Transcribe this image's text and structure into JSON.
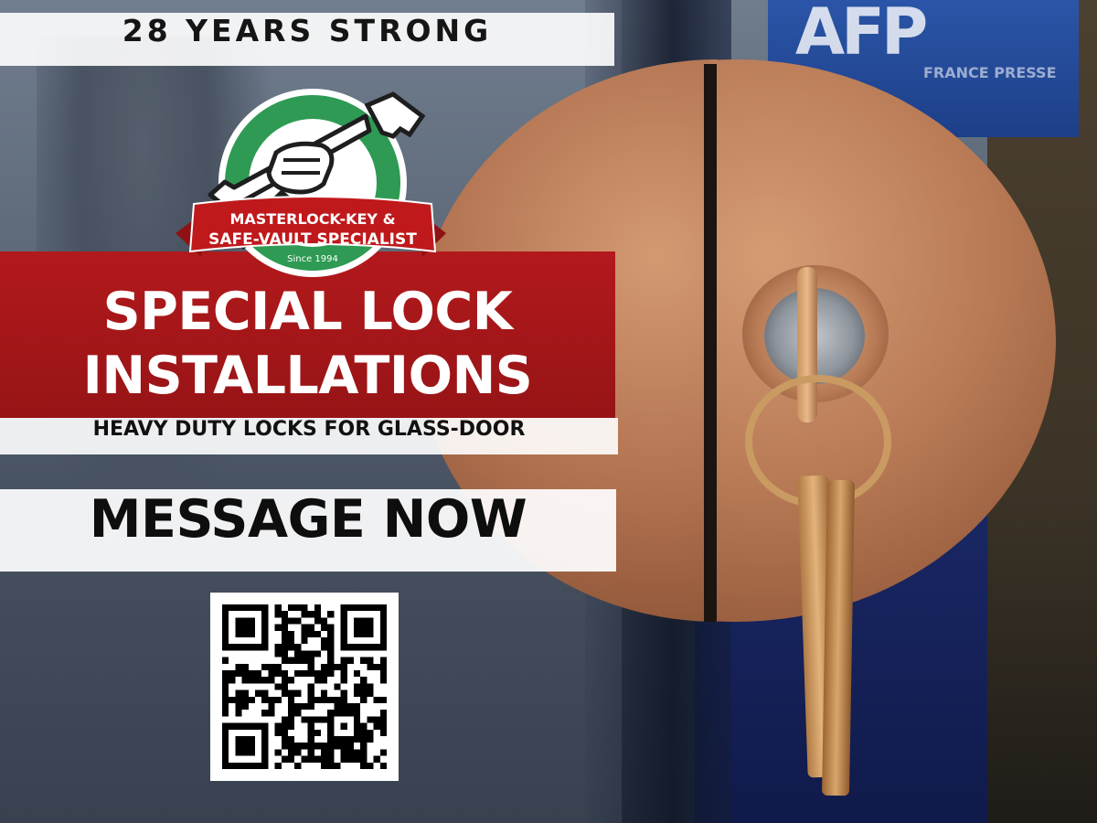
{
  "badge": {
    "years_text": "28 YEARS STRONG"
  },
  "logo": {
    "line1": "MASTERLOCK-KEY &",
    "line2": "SAFE-VAULT SPECIALIST",
    "since": "Since 1994",
    "colors": {
      "green": "#2e9a53",
      "red": "#c0191c",
      "dark": "#1e1e1e"
    }
  },
  "headline": {
    "line1": "SPECIAL LOCK",
    "line2": "INSTALLATIONS",
    "subtitle": "HEAVY DUTY LOCKS FOR GLASS-DOOR",
    "band_color": "#a8171a"
  },
  "cta": {
    "label": "MESSAGE NOW"
  },
  "qr": {
    "icon": "qr-code-icon"
  },
  "background": {
    "poster_text": "AFP",
    "poster_sub": "FRANCE PRESSE"
  }
}
